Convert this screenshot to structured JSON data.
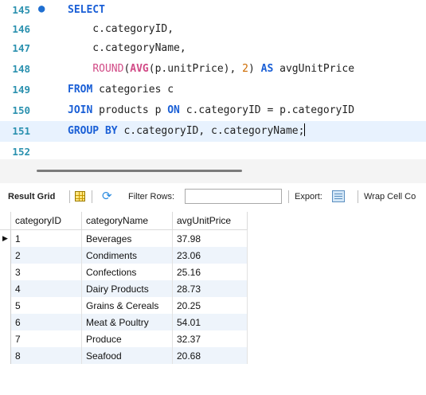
{
  "editor": {
    "lines": [
      {
        "num": "145",
        "text": "SELECT",
        "marker": "●"
      },
      {
        "num": "146",
        "text": "    c.categoryID,"
      },
      {
        "num": "147",
        "text": "    c.categoryName,"
      },
      {
        "num": "148",
        "text": "    ROUND(AVG(p.unitPrice), 2) AS avgUnitPrice"
      },
      {
        "num": "149",
        "text": "FROM categories c"
      },
      {
        "num": "150",
        "text": "JOIN products p ON c.categoryID = p.categoryID"
      },
      {
        "num": "151",
        "text": "GROUP BY c.categoryID, c.categoryName;"
      },
      {
        "num": "152",
        "text": ""
      }
    ]
  },
  "toolbar": {
    "result_grid_label": "Result Grid",
    "filter_rows_label": "Filter Rows:",
    "filter_value": "",
    "export_label": "Export:",
    "wrap_label": "Wrap Cell Co"
  },
  "grid": {
    "columns": [
      "categoryID",
      "categoryName",
      "avgUnitPrice"
    ],
    "row_marker": "▶",
    "rows": [
      [
        "1",
        "Beverages",
        "37.98"
      ],
      [
        "2",
        "Condiments",
        "23.06"
      ],
      [
        "3",
        "Confections",
        "25.16"
      ],
      [
        "4",
        "Dairy Products",
        "28.73"
      ],
      [
        "5",
        "Grains & Cereals",
        "20.25"
      ],
      [
        "6",
        "Meat & Poultry",
        "54.01"
      ],
      [
        "7",
        "Produce",
        "32.37"
      ],
      [
        "8",
        "Seafood",
        "20.68"
      ]
    ]
  },
  "colors": {
    "keyword": "#1a5fd6",
    "function": "#d14a86",
    "number": "#cd6a00",
    "line_number": "#2b91af",
    "row_stripe": "#eef4fb"
  }
}
